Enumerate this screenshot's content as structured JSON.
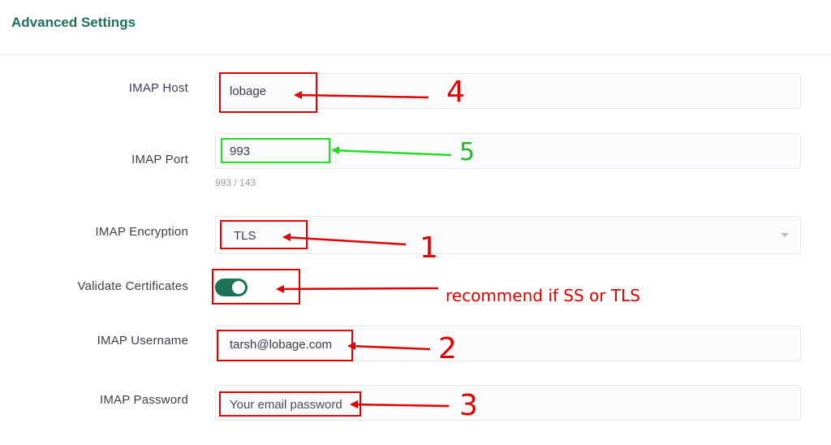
{
  "section": {
    "title": "Advanced Settings"
  },
  "fields": {
    "imap_host": {
      "label": "IMAP Host",
      "value": "lobage"
    },
    "imap_port": {
      "label": "IMAP Port",
      "value": "993",
      "hint": "993 / 143"
    },
    "imap_encryption": {
      "label": "IMAP Encryption",
      "value": "TLS"
    },
    "validate_certificates": {
      "label": "Validate Certificates",
      "enabled": true
    },
    "imap_username": {
      "label": "IMAP Username",
      "value": "tarsh@lobage.com"
    },
    "imap_password": {
      "label": "IMAP Password",
      "placeholder": "Your email password"
    }
  },
  "annotations": {
    "host": "4",
    "port": "5",
    "encryption": "1",
    "toggle_note": "recommend if SS or TLS",
    "username": "2",
    "password": "3"
  },
  "colors": {
    "brand_green": "#1c7257",
    "annotation_red": "#e00000",
    "annotation_green": "#22dd22"
  },
  "icons": [
    "chevron-down-icon"
  ]
}
